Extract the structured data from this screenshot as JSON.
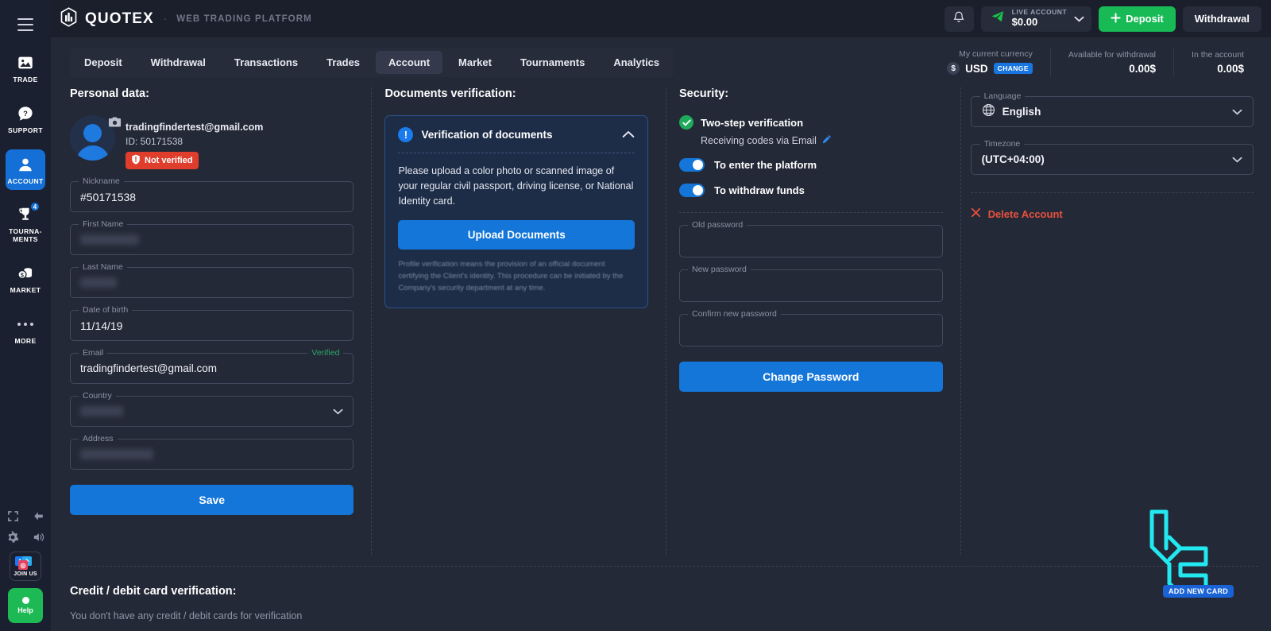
{
  "brand": {
    "name": "QUOTEX",
    "separator": "·",
    "subtitle": "WEB TRADING PLATFORM"
  },
  "rail": {
    "items": [
      {
        "label": "TRADE",
        "icon": "chart-image-icon",
        "active": false,
        "badge": ""
      },
      {
        "label": "SUPPORT",
        "icon": "question-bubble-icon",
        "active": false,
        "badge": ""
      },
      {
        "label": "ACCOUNT",
        "icon": "user-icon",
        "active": true,
        "badge": ""
      },
      {
        "label": "TOURNA-\nMENTS",
        "icon": "trophy-icon",
        "active": false,
        "badge": "4"
      },
      {
        "label": "MARKET",
        "icon": "coins-icon",
        "active": false,
        "badge": ""
      },
      {
        "label": "MORE",
        "icon": "ellipsis-icon",
        "active": false,
        "badge": ""
      }
    ],
    "join_us_label": "JOIN US",
    "help_label": "Help"
  },
  "header": {
    "bell_icon": "bell-icon",
    "account": {
      "type_label": "LIVE ACCOUNT",
      "balance": "$0.00",
      "icon": "paper-plane-icon"
    },
    "deposit_label": "Deposit",
    "withdrawal_label": "Withdrawal"
  },
  "tabs": [
    {
      "label": "Deposit",
      "active": false
    },
    {
      "label": "Withdrawal",
      "active": false
    },
    {
      "label": "Transactions",
      "active": false
    },
    {
      "label": "Trades",
      "active": false
    },
    {
      "label": "Account",
      "active": true
    },
    {
      "label": "Market",
      "active": false
    },
    {
      "label": "Tournaments",
      "active": false
    },
    {
      "label": "Analytics",
      "active": false
    }
  ],
  "info_strip": {
    "currency_label": "My current currency",
    "currency_symbol": "$",
    "currency_code": "USD",
    "change_label": "CHANGE",
    "available_label": "Available for withdrawal",
    "available_value": "0.00$",
    "in_account_label": "In the account",
    "in_account_value": "0.00$"
  },
  "personal": {
    "title": "Personal data:",
    "email": "tradingfindertest@gmail.com",
    "id": "ID: 50171538",
    "not_verified_label": "Not verified",
    "fields": [
      {
        "label": "Nickname",
        "value": "#50171538",
        "redacted": false
      },
      {
        "label": "First Name",
        "value": "",
        "redacted": true
      },
      {
        "label": "Last Name",
        "value": "",
        "redacted": true
      },
      {
        "label": "Date of birth",
        "value": "11/14/19",
        "redacted": false
      },
      {
        "label": "Email",
        "value": "tradingfindertest@gmail.com",
        "redacted": false,
        "right_note": "Verified"
      },
      {
        "label": "Country",
        "value": "",
        "redacted": true,
        "dropdown": true
      },
      {
        "label": "Address",
        "value": "",
        "redacted": true
      }
    ],
    "save_label": "Save"
  },
  "documents": {
    "title": "Documents verification:",
    "panel_title": "Verification of documents",
    "body": "Please upload a color photo or scanned image of your regular civil passport, driving license, or National Identity card.",
    "upload_label": "Upload Documents",
    "note": "Profile verification means the provision of an official document certifying the Client's identity. This procedure can be initiated by the Company's security department at any time."
  },
  "security": {
    "title": "Security:",
    "two_step_label": "Two-step verification",
    "two_step_sub": "Receiving codes via Email",
    "toggles": [
      {
        "label": "To enter the platform",
        "on": true
      },
      {
        "label": "To withdraw funds",
        "on": true
      }
    ],
    "password_fields": [
      {
        "label": "Old password",
        "value": ""
      },
      {
        "label": "New password",
        "value": ""
      },
      {
        "label": "Confirm new password",
        "value": ""
      }
    ],
    "change_password_label": "Change Password"
  },
  "settings": {
    "language_label": "Language",
    "language_value": "English",
    "timezone_label": "Timezone",
    "timezone_value": "(UTC+04:00)",
    "delete_label": "Delete Account"
  },
  "cards": {
    "title": "Credit / debit card verification:",
    "empty_text": "You don't have any credit / debit cards for verification",
    "add_new_card_label": "ADD NEW CARD"
  },
  "colors": {
    "background": "#242937",
    "header": "#1b1f2c",
    "rail": "#1b2030",
    "accent_blue": "#1476d9",
    "green": "#18ba55",
    "red": "#e03e2d",
    "watermark_cyan": "#22e8f0"
  }
}
